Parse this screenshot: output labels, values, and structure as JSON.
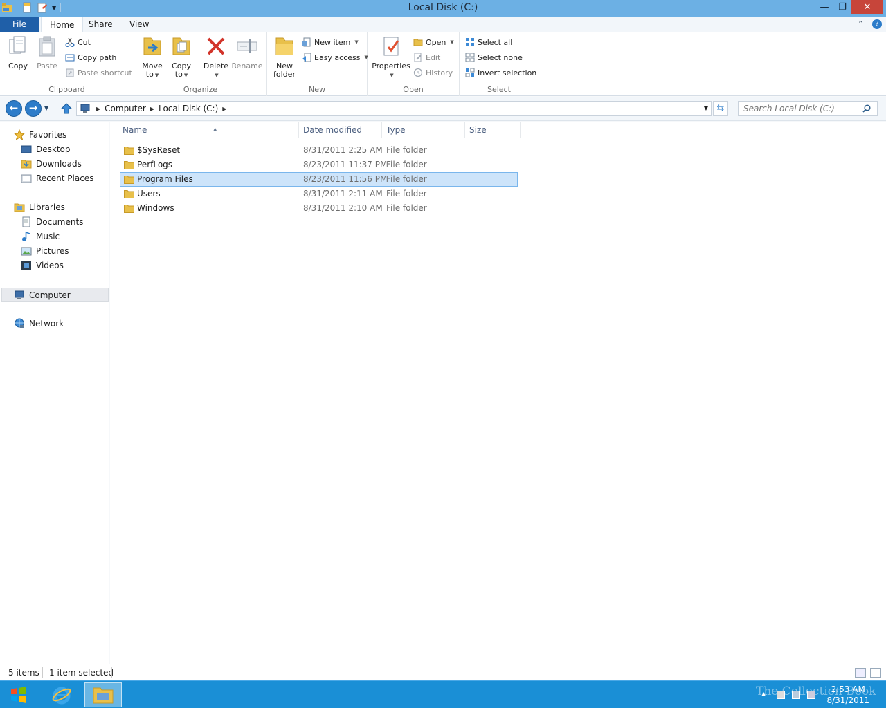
{
  "window": {
    "title": "Local Disk (C:)",
    "controls": {
      "minimize": "—",
      "maximize": "❐",
      "close": "✕"
    }
  },
  "tabs": {
    "file": "File",
    "home": "Home",
    "share": "Share",
    "view": "View"
  },
  "ribbon": {
    "clipboard": {
      "label": "Clipboard",
      "copy": "Copy",
      "paste": "Paste",
      "cut": "Cut",
      "copy_path": "Copy path",
      "paste_shortcut": "Paste shortcut"
    },
    "organize": {
      "label": "Organize",
      "move_to": [
        "Move",
        "to"
      ],
      "copy_to": [
        "Copy",
        "to"
      ],
      "delete": "Delete",
      "rename": "Rename"
    },
    "new": {
      "label": "New",
      "new_folder": [
        "New",
        "folder"
      ],
      "new_item": "New item",
      "easy_access": "Easy access"
    },
    "open": {
      "label": "Open",
      "properties": "Properties",
      "open": "Open",
      "edit": "Edit",
      "history": "History"
    },
    "select": {
      "label": "Select",
      "select_all": "Select all",
      "select_none": "Select none",
      "invert_selection": "Invert selection"
    }
  },
  "address": {
    "crumbs": [
      "Computer",
      "Local Disk (C:)"
    ],
    "search_placeholder": "Search Local Disk (C:)"
  },
  "nav": {
    "favorites": "Favorites",
    "desktop": "Desktop",
    "downloads": "Downloads",
    "recent_places": "Recent Places",
    "libraries": "Libraries",
    "documents": "Documents",
    "music": "Music",
    "pictures": "Pictures",
    "videos": "Videos",
    "computer": "Computer",
    "network": "Network"
  },
  "columns": {
    "name": "Name",
    "date": "Date modified",
    "type": "Type",
    "size": "Size"
  },
  "files": [
    {
      "name": "$SysReset",
      "date": "8/31/2011 2:25 AM",
      "type": "File folder"
    },
    {
      "name": "PerfLogs",
      "date": "8/23/2011 11:37 PM",
      "type": "File folder"
    },
    {
      "name": "Program Files",
      "date": "8/23/2011 11:56 PM",
      "type": "File folder"
    },
    {
      "name": "Users",
      "date": "8/31/2011 2:11 AM",
      "type": "File folder"
    },
    {
      "name": "Windows",
      "date": "8/31/2011 2:10 AM",
      "type": "File folder"
    }
  ],
  "status": {
    "items": "5 items",
    "selected": "1 item selected"
  },
  "taskbar": {
    "clock_time": "2:53 AM",
    "clock_date": "8/31/2011",
    "watermark": "The Collection Book"
  },
  "colors": {
    "titlebar": "#6cb0e4",
    "file_tab": "#1f5fa8",
    "taskbar": "#1a8fd6",
    "selection": "#cde4fa"
  }
}
